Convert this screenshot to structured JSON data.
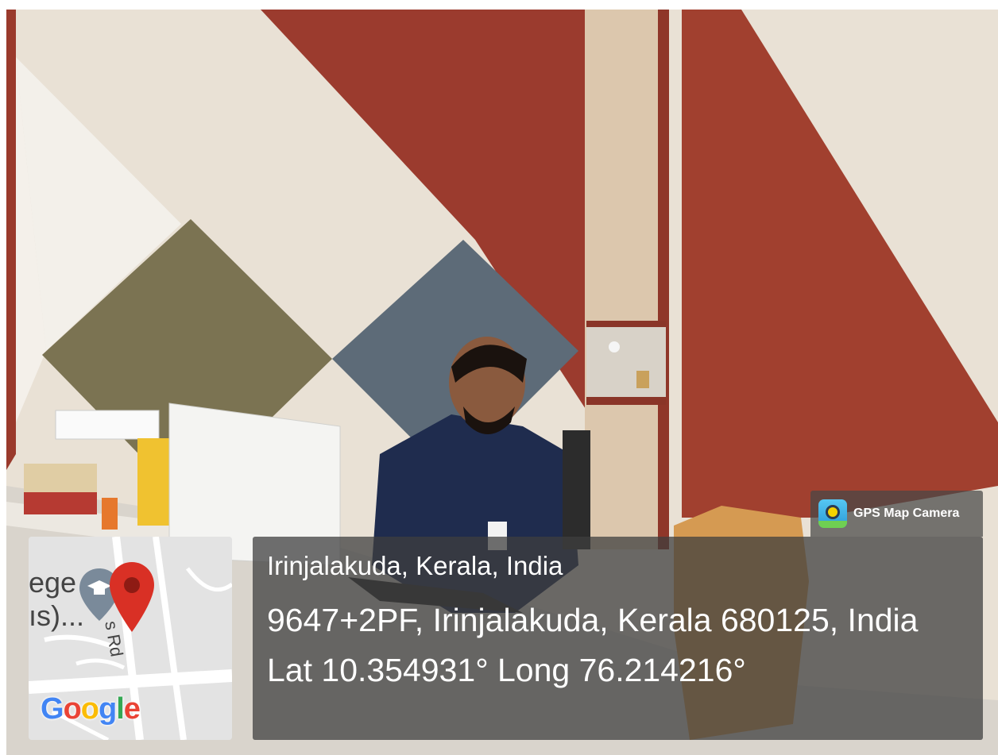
{
  "photo": {
    "scene": "office-desk-with-person",
    "colors": {
      "wall_red": "#9b3b2e",
      "wall_beige": "#e7dccd",
      "panel_olive": "#7b7352",
      "panel_blue": "#5d6b78",
      "shirt_navy": "#1f2c4e"
    }
  },
  "overlay": {
    "badge_label": "GPS Map Camera",
    "badge_icon": "gps-map-camera-logo-icon",
    "location_title": "Irinjalakuda, Kerala, India",
    "address": "9647+2PF, Irinjalakuda, Kerala 680125, India",
    "coordinates": "Lat 10.354931° Long 76.214216°"
  },
  "map": {
    "label_left_top": "ege",
    "label_left_bottom": "ıs)...",
    "road_label": "Fr    s Rd",
    "brand": "Google",
    "pin_color": "#d93025",
    "marker_icon": "graduation-cap-marker-icon"
  }
}
